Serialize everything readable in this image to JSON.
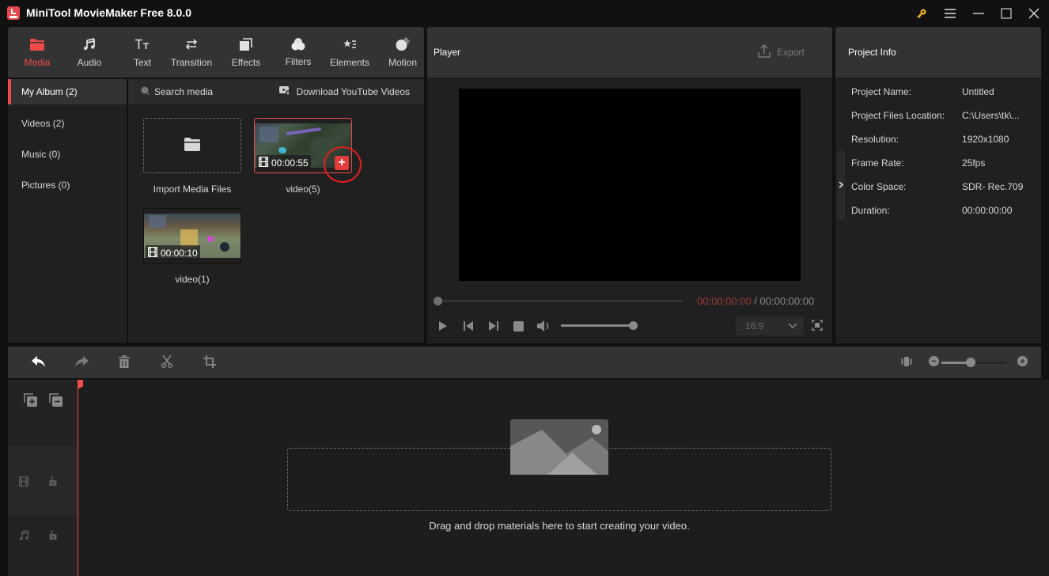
{
  "app": {
    "title": "MiniTool MovieMaker Free 8.0.0",
    "icons": [
      "key-icon",
      "menu-icon",
      "minimize-icon",
      "maximize-icon",
      "close-icon"
    ]
  },
  "toolbar": {
    "tabs": [
      {
        "label": "Media",
        "icon": "folder-icon",
        "active": true
      },
      {
        "label": "Audio",
        "icon": "music-icon",
        "active": false
      },
      {
        "label": "Text",
        "icon": "text-icon",
        "active": false
      },
      {
        "label": "Transition",
        "icon": "transition-icon",
        "active": false
      },
      {
        "label": "Effects",
        "icon": "effects-icon",
        "active": false
      },
      {
        "label": "Filters",
        "icon": "filters-icon",
        "active": false
      },
      {
        "label": "Elements",
        "icon": "elements-icon",
        "active": false
      },
      {
        "label": "Motion",
        "icon": "motion-icon",
        "active": false
      }
    ]
  },
  "sidebar": {
    "items": [
      {
        "label": "My Album (2)",
        "active": true
      },
      {
        "label": "Videos (2)",
        "active": false
      },
      {
        "label": "Music (0)",
        "active": false
      },
      {
        "label": "Pictures (0)",
        "active": false
      }
    ]
  },
  "media": {
    "search_placeholder": "Search media",
    "download_label": "Download YouTube Videos",
    "import_label": "Import Media Files",
    "items": [
      {
        "name": "video(5)",
        "duration": "00:00:55",
        "selected": true
      },
      {
        "name": "video(1)",
        "duration": "00:00:10",
        "selected": false
      }
    ],
    "add_button_label": "+"
  },
  "player": {
    "title": "Player",
    "export_label": "Export",
    "current_time": "00:00:00:00",
    "separator": " / ",
    "total_time": "00:00:00:00",
    "seek_progress": 0,
    "volume": 1.0,
    "aspect_ratio": "16:9"
  },
  "project_info": {
    "title": "Project Info",
    "rows": [
      {
        "key": "Project Name:",
        "value": "Untitled"
      },
      {
        "key": "Project Files Location:",
        "value": "C:\\Users\\tk\\..."
      },
      {
        "key": "Resolution:",
        "value": "1920x1080"
      },
      {
        "key": "Frame Rate:",
        "value": "25fps"
      },
      {
        "key": "Color Space:",
        "value": "SDR- Rec.709"
      },
      {
        "key": "Duration:",
        "value": "00:00:00:00"
      }
    ]
  },
  "timeline": {
    "zoom_level": 0.5,
    "drop_hint": "Drag and drop materials here to start creating your video."
  },
  "colors": {
    "accent": "#ef4b4b",
    "panel_header": "#333333",
    "panel_body": "#202020",
    "background": "#111111"
  }
}
